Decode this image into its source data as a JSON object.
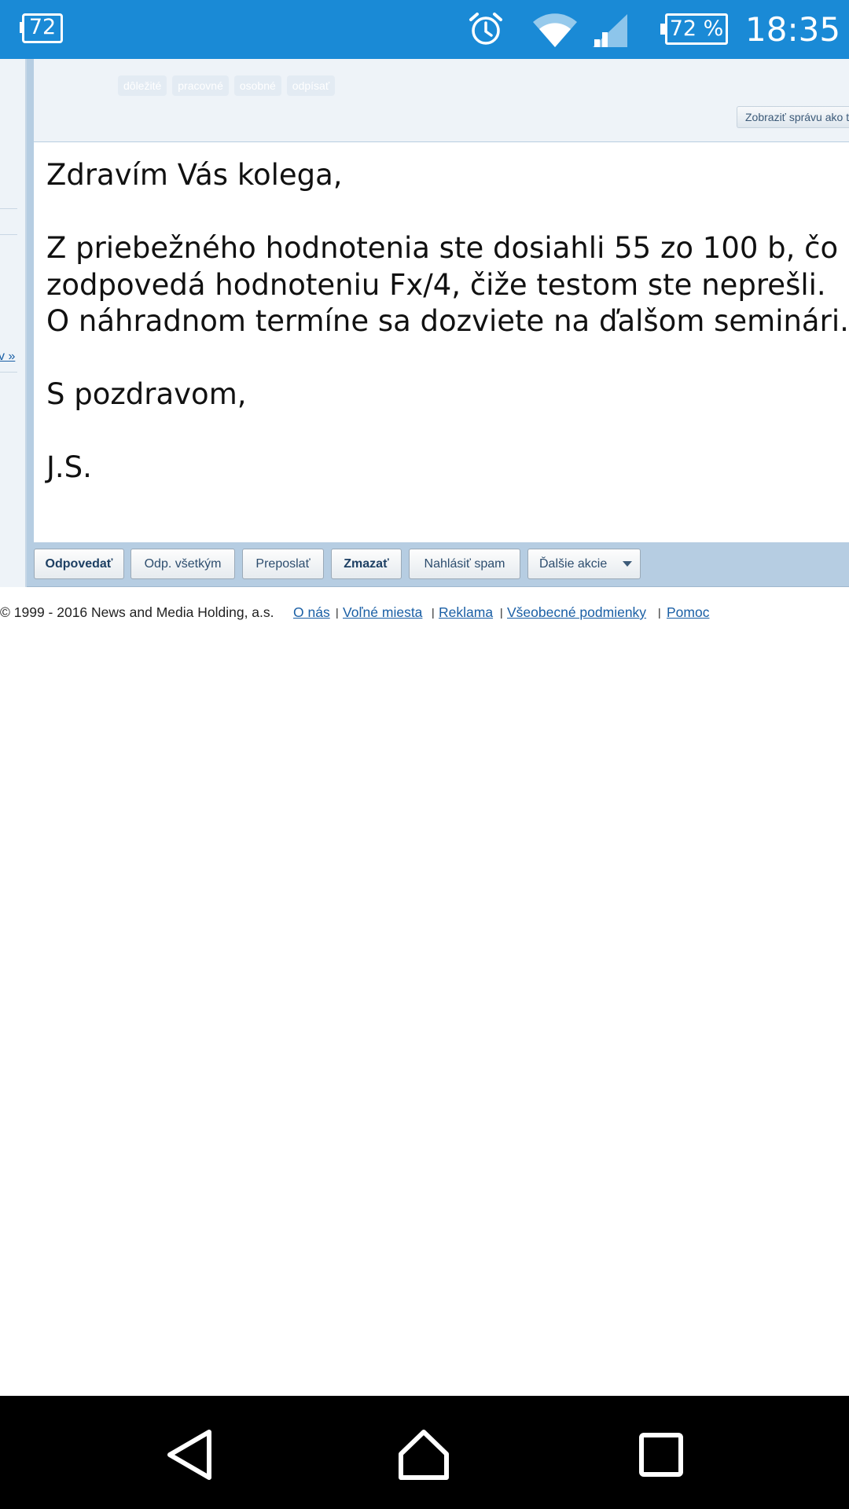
{
  "status_bar": {
    "notification_count": "72",
    "battery_percent": "72 %",
    "battery_level": 0.72,
    "time": "18:35",
    "icons": [
      "notification-icon",
      "alarm-icon",
      "wifi-icon",
      "cell-signal-icon",
      "battery-icon"
    ]
  },
  "sidebar": {
    "more_link": "v »"
  },
  "message": {
    "labels": [
      "dôležité",
      "pracovné",
      "osobné",
      "odpísať"
    ],
    "view_raw_button": "Zobraziť správu ako t",
    "body": {
      "greeting": "Zdravím Vás kolega,",
      "line1": "Z priebežného hodnotenia ste dosiahli 55 zo 100 b, čo",
      "line2": "zodpovedá hodnoteniu Fx/4, čiže testom ste neprešli.",
      "line3": "O náhradnom termíne sa dozviete na ďalšom seminári.",
      "closing": "S pozdravom,",
      "signature": "J.S."
    }
  },
  "toolbar": {
    "reply": "Odpovedať",
    "reply_all": "Odp. všetkým",
    "forward": "Preposlať",
    "delete": "Zmazať",
    "report_spam": "Nahlásiť spam",
    "more_actions": "Ďalšie akcie"
  },
  "footer": {
    "copyright": "© 1999 - 2016 News and Media Holding, a.s.",
    "links": {
      "about": "O nás",
      "jobs": "Voľné miesta",
      "ads": "Reklama",
      "terms": "Všeobecné podmienky",
      "help": "Pomoc"
    },
    "separator": "|"
  },
  "colors": {
    "status_bar": "#1a8ad6",
    "toolbar": "#b6cde2",
    "header_bg": "#eef3f8",
    "link": "#1a5fa5"
  }
}
